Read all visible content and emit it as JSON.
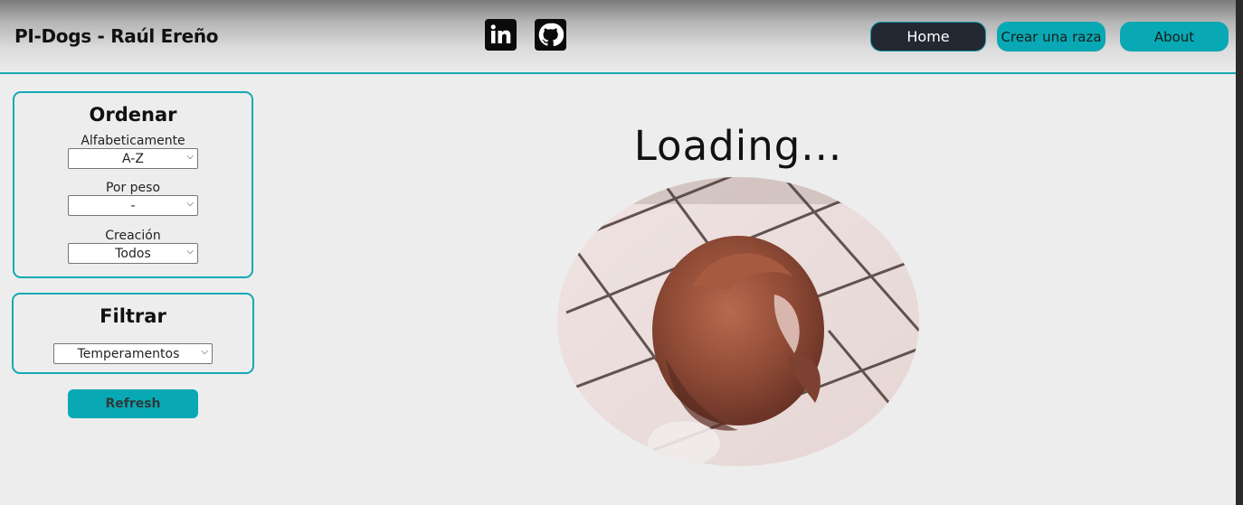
{
  "header": {
    "brand": "PI-Dogs - Raúl Ereño",
    "social": [
      {
        "name": "linkedin",
        "glyph": "in"
      },
      {
        "name": "github"
      }
    ],
    "nav": {
      "home": "Home",
      "create": "Crear una raza",
      "about": "About"
    }
  },
  "sidebar": {
    "order": {
      "title": "Ordenar",
      "alpha_label": "Alfabeticamente",
      "alpha_value": "A-Z",
      "weight_label": "Por peso",
      "weight_value": "-",
      "creation_label": "Creación",
      "creation_value": "Todos"
    },
    "filter": {
      "title": "Filtrar",
      "temperament_value": "Temperamentos"
    },
    "refresh_label": "Refresh"
  },
  "main": {
    "loading_text": "Loading...",
    "loading_image": "spinning-dog-gif"
  },
  "colors": {
    "accent": "#08a9b4",
    "home_button": "#232833",
    "background": "#ededed"
  }
}
